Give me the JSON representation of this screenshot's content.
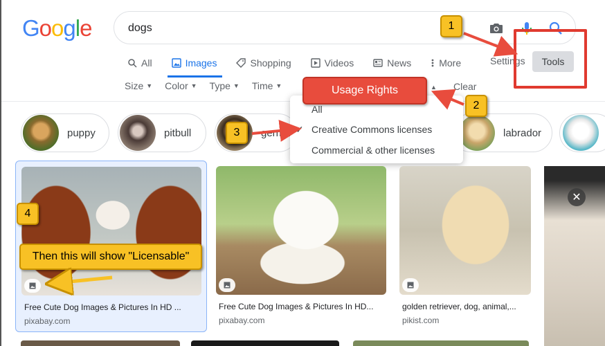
{
  "logo": {
    "letters": [
      "G",
      "o",
      "o",
      "g",
      "l",
      "e"
    ],
    "colors": [
      "#4285F4",
      "#EA4335",
      "#FBBC05",
      "#4285F4",
      "#34A853",
      "#EA4335"
    ]
  },
  "search": {
    "value": "dogs"
  },
  "tabs": [
    {
      "label": "All",
      "icon": "search-icon"
    },
    {
      "label": "Images",
      "icon": "image-icon"
    },
    {
      "label": "Shopping",
      "icon": "tag-icon"
    },
    {
      "label": "Videos",
      "icon": "play-icon"
    },
    {
      "label": "News",
      "icon": "news-icon"
    },
    {
      "label": "More",
      "icon": "more-vert-icon"
    }
  ],
  "settings_label": "Settings",
  "tools_label": "Tools",
  "filters": [
    {
      "label": "Size"
    },
    {
      "label": "Color"
    },
    {
      "label": "Type"
    },
    {
      "label": "Time"
    }
  ],
  "clear_label": "Clear",
  "usage_rights": {
    "banner_label": "Usage Rights",
    "options": [
      {
        "label": "All",
        "checked": false
      },
      {
        "label": "Creative Commons licenses",
        "checked": true
      },
      {
        "label": "Commercial & other licenses",
        "checked": false
      }
    ]
  },
  "chips": [
    {
      "label": "puppy"
    },
    {
      "label": "pitbull"
    },
    {
      "label": "german shepherd"
    },
    {
      "label": "labrador"
    }
  ],
  "callouts": {
    "step1": "1",
    "step2": "2",
    "step3": "3",
    "step4": "4",
    "licensable_note": "Then this will show \"Licensable\""
  },
  "results": [
    {
      "caption": "Free Cute Dog Images & Pictures In HD ...",
      "source": "pixabay.com"
    },
    {
      "caption": "Free Cute Dog Images & Pictures In HD...",
      "source": "pixabay.com"
    },
    {
      "caption": "golden retriever, dog, animal,...",
      "source": "pikist.com"
    }
  ],
  "colors": {
    "accent": "#1a73e8",
    "callout_red": "#e84c3d",
    "callout_yellow": "#f8c125",
    "highlight_box": "#e03a2f"
  }
}
